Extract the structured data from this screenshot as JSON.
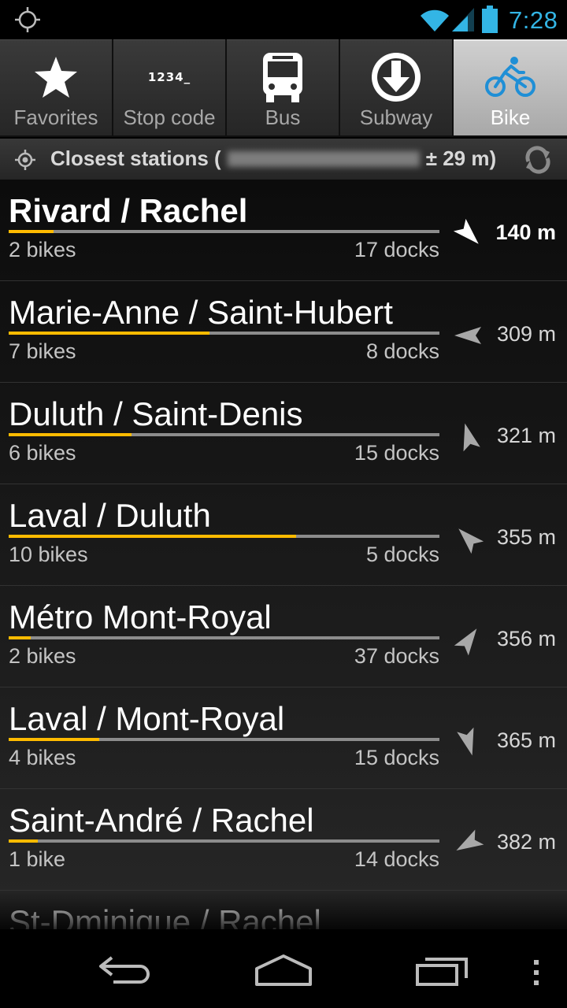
{
  "status": {
    "time": "7:28"
  },
  "tabs": [
    {
      "label": "Favorites",
      "icon": "star-icon",
      "active": false
    },
    {
      "label": "Stop code",
      "icon": "keypad-code-icon",
      "code_text": "1234_",
      "active": false
    },
    {
      "label": "Bus",
      "icon": "bus-icon",
      "active": false
    },
    {
      "label": "Subway",
      "icon": "subway-arrow-icon",
      "active": false
    },
    {
      "label": "Bike",
      "icon": "bicycle-icon",
      "active": true
    }
  ],
  "header": {
    "title_prefix": "Closest stations (",
    "accuracy": "± 29 m)"
  },
  "stations": [
    {
      "name": "Rivard / Rachel",
      "bikes": "2 bikes",
      "docks": "17 docks",
      "distance": "140 m",
      "fill_fraction": 0.105,
      "heading_deg": 135
    },
    {
      "name": "Marie-Anne / Saint-Hubert",
      "bikes": "7 bikes",
      "docks": "8 docks",
      "distance": "309 m",
      "fill_fraction": 0.467,
      "heading_deg": -90
    },
    {
      "name": "Duluth / Saint-Denis",
      "bikes": "6 bikes",
      "docks": "15 docks",
      "distance": "321 m",
      "fill_fraction": 0.286,
      "heading_deg": -15
    },
    {
      "name": "Laval / Duluth",
      "bikes": "10 bikes",
      "docks": "5 docks",
      "distance": "355 m",
      "fill_fraction": 0.667,
      "heading_deg": -45
    },
    {
      "name": "Métro Mont-Royal",
      "bikes": "2 bikes",
      "docks": "37 docks",
      "distance": "356 m",
      "fill_fraction": 0.051,
      "heading_deg": 35
    },
    {
      "name": "Laval / Mont-Royal",
      "bikes": "4 bikes",
      "docks": "15 docks",
      "distance": "365 m",
      "fill_fraction": 0.211,
      "heading_deg": 165
    },
    {
      "name": "Saint-André / Rachel",
      "bikes": "1 bike",
      "docks": "14 docks",
      "distance": "382 m",
      "fill_fraction": 0.067,
      "heading_deg": -120
    },
    {
      "name": "St-Dminique / Rachel",
      "bikes": "",
      "docks": "",
      "distance": "",
      "fill_fraction": 0,
      "heading_deg": 0
    }
  ],
  "colors": {
    "accent": "#ffbb00",
    "status_blue": "#33b5e5"
  }
}
